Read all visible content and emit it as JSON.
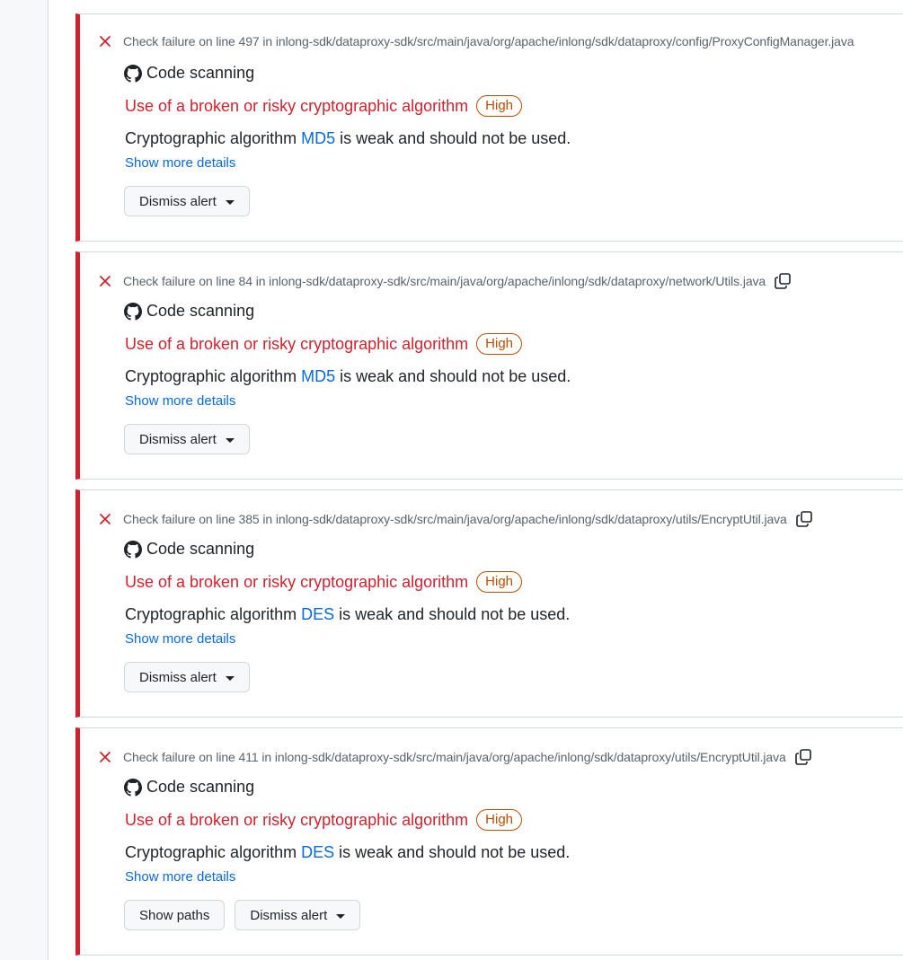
{
  "colors": {
    "failure": "#cf222e",
    "severity_high": "#bc4c00",
    "link": "#0969da"
  },
  "annotations": [
    {
      "header": "Check failure on line 497 in inlong-sdk/dataproxy-sdk/src/main/java/org/apache/inlong/sdk/dataproxy/config/ProxyConfigManager.java",
      "show_copy": false,
      "tool": "Code scanning",
      "rule_title": "Use of a broken or risky cryptographic algorithm",
      "severity": "High",
      "message_prefix": "Cryptographic algorithm ",
      "algorithm": "MD5",
      "message_suffix": " is weak and should not be used.",
      "details_link": "Show more details",
      "show_paths": null,
      "dismiss_label": "Dismiss alert"
    },
    {
      "header": "Check failure on line 84 in inlong-sdk/dataproxy-sdk/src/main/java/org/apache/inlong/sdk/dataproxy/network/Utils.java",
      "show_copy": true,
      "tool": "Code scanning",
      "rule_title": "Use of a broken or risky cryptographic algorithm",
      "severity": "High",
      "message_prefix": "Cryptographic algorithm ",
      "algorithm": "MD5",
      "message_suffix": " is weak and should not be used.",
      "details_link": "Show more details",
      "show_paths": null,
      "dismiss_label": "Dismiss alert"
    },
    {
      "header": "Check failure on line 385 in inlong-sdk/dataproxy-sdk/src/main/java/org/apache/inlong/sdk/dataproxy/utils/EncryptUtil.java",
      "show_copy": true,
      "tool": "Code scanning",
      "rule_title": "Use of a broken or risky cryptographic algorithm",
      "severity": "High",
      "message_prefix": "Cryptographic algorithm ",
      "algorithm": "DES",
      "message_suffix": " is weak and should not be used.",
      "details_link": "Show more details",
      "show_paths": null,
      "dismiss_label": "Dismiss alert"
    },
    {
      "header": "Check failure on line 411 in inlong-sdk/dataproxy-sdk/src/main/java/org/apache/inlong/sdk/dataproxy/utils/EncryptUtil.java",
      "show_copy": true,
      "tool": "Code scanning",
      "rule_title": "Use of a broken or risky cryptographic algorithm",
      "severity": "High",
      "message_prefix": "Cryptographic algorithm ",
      "algorithm": "DES",
      "message_suffix": " is weak and should not be used.",
      "details_link": "Show more details",
      "show_paths": "Show paths",
      "dismiss_label": "Dismiss alert"
    }
  ]
}
